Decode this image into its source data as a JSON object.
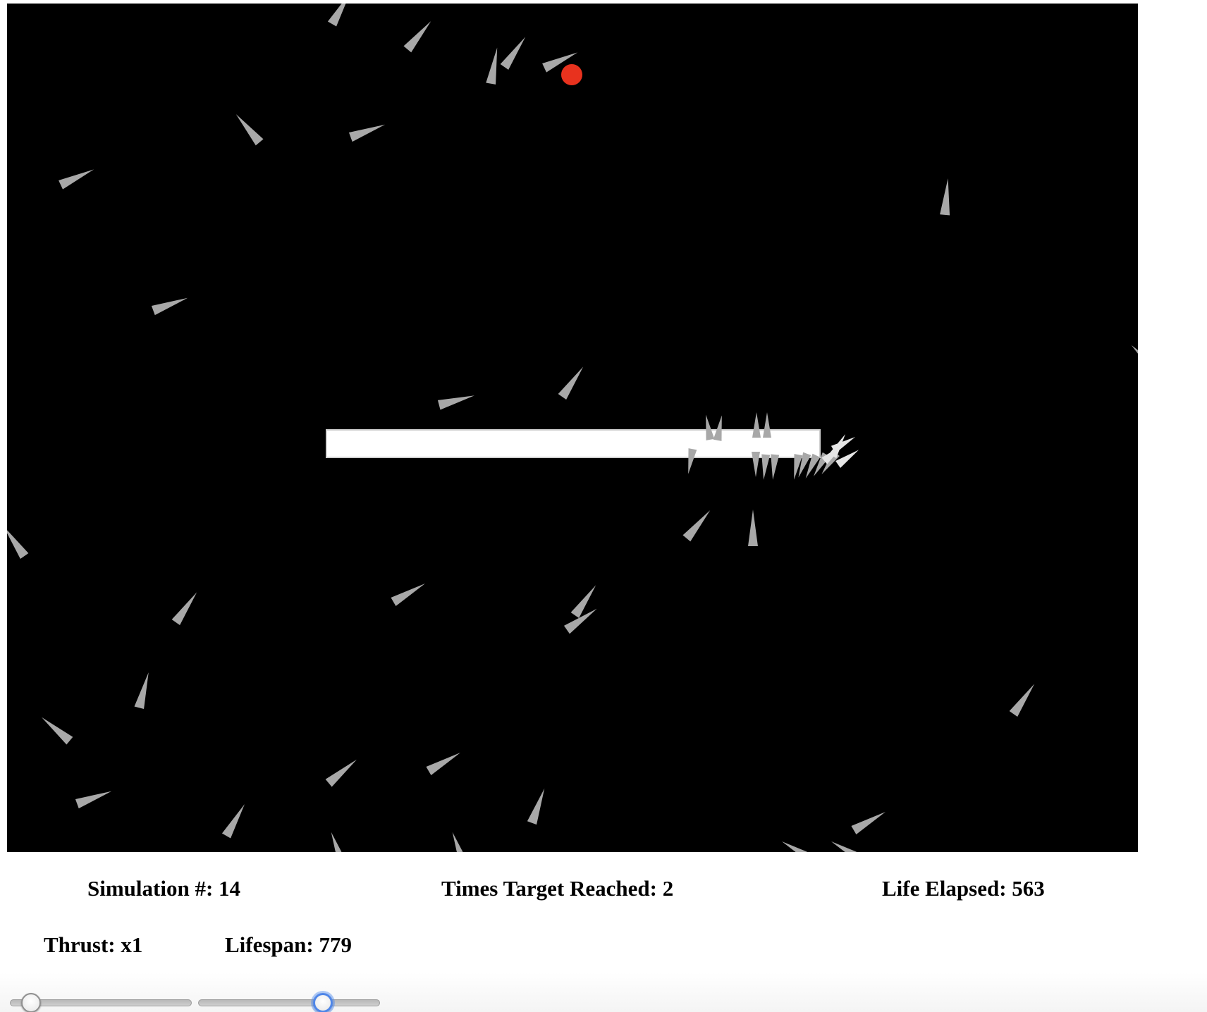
{
  "stats": {
    "simulation_label": "Simulation #:",
    "simulation_value": "14",
    "target_label": "Times Target Reached:",
    "target_value": "2",
    "life_label": "Life Elapsed:",
    "life_value": "563"
  },
  "controls": {
    "thrust_label": "Thrust:",
    "thrust_value": "x1",
    "lifespan_label": "Lifespan:",
    "lifespan_value": "779",
    "thrust_slider_level": 0.07,
    "lifespan_slider_level": 0.71
  },
  "colors": {
    "canvas_background": "#000000",
    "rocket": "#a8a8a8",
    "target": "#e8321e",
    "obstacle": "#ffffff"
  }
}
